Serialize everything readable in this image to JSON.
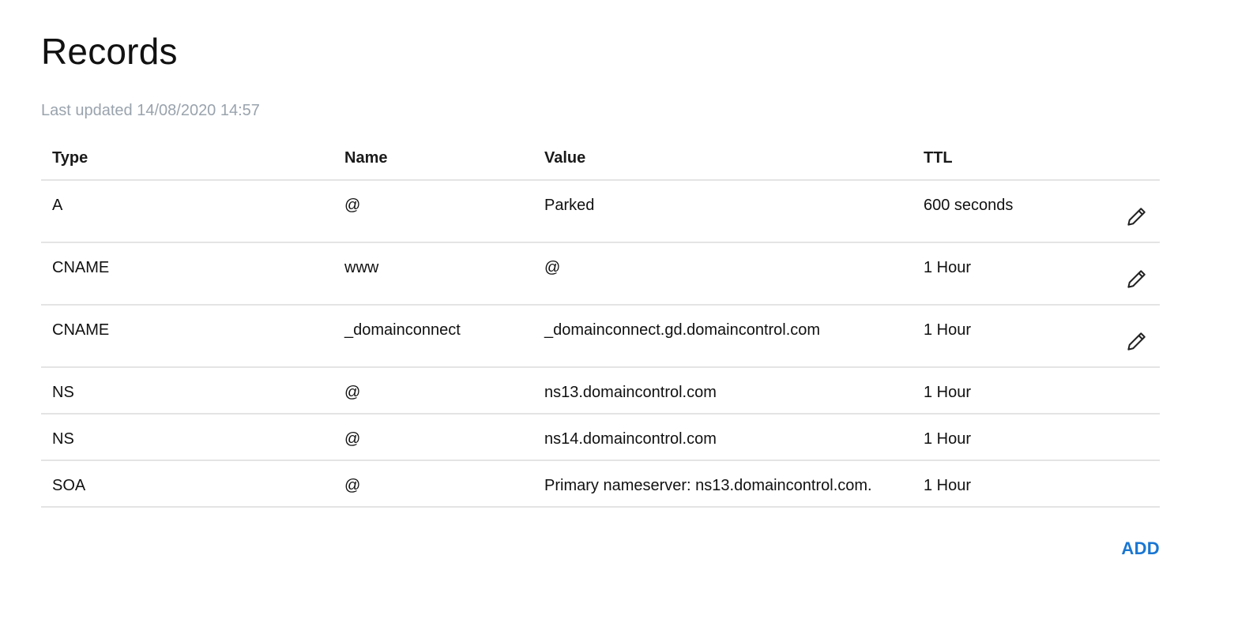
{
  "page": {
    "title": "Records",
    "last_updated": "Last updated 14/08/2020 14:57"
  },
  "table": {
    "columns": {
      "type": "Type",
      "name": "Name",
      "value": "Value",
      "ttl": "TTL"
    },
    "rows": [
      {
        "type": "A",
        "name": "@",
        "value": "Parked",
        "ttl": "600 seconds",
        "editable": true
      },
      {
        "type": "CNAME",
        "name": "www",
        "value": "@",
        "ttl": "1 Hour",
        "editable": true
      },
      {
        "type": "CNAME",
        "name": "_domainconnect",
        "value": "_domainconnect.gd.domaincontrol.com",
        "ttl": "1 Hour",
        "editable": true
      },
      {
        "type": "NS",
        "name": "@",
        "value": "ns13.domaincontrol.com",
        "ttl": "1 Hour",
        "editable": false
      },
      {
        "type": "NS",
        "name": "@",
        "value": "ns14.domaincontrol.com",
        "ttl": "1 Hour",
        "editable": false
      },
      {
        "type": "SOA",
        "name": "@",
        "value": "Primary nameserver: ns13.domaincontrol.com.",
        "ttl": "1 Hour",
        "editable": false
      }
    ]
  },
  "actions": {
    "add_label": "ADD"
  },
  "icons": {
    "edit": "pencil-icon"
  },
  "colors": {
    "accent": "#1976d2",
    "muted_text": "#9aa3ad",
    "divider": "#e4e4e4"
  }
}
